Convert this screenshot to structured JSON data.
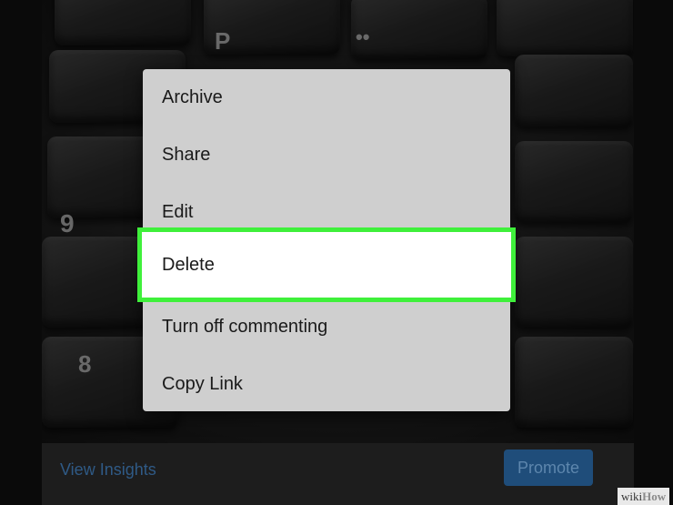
{
  "menu": {
    "items": [
      {
        "label": "Archive"
      },
      {
        "label": "Share"
      },
      {
        "label": "Edit"
      },
      {
        "label": "Delete",
        "highlighted": true
      },
      {
        "label": "Turn off commenting"
      },
      {
        "label": "Copy Link"
      }
    ]
  },
  "bottom_bar": {
    "insights_label": "View Insights",
    "promote_label": "Promote"
  },
  "watermark": {
    "part1": "wiki",
    "part2": "How"
  },
  "colors": {
    "highlight_border": "#3ff03b",
    "menu_bg": "#cfcfcf",
    "promote_bg": "#1f4d7a",
    "link_blue": "#2f5a86"
  }
}
